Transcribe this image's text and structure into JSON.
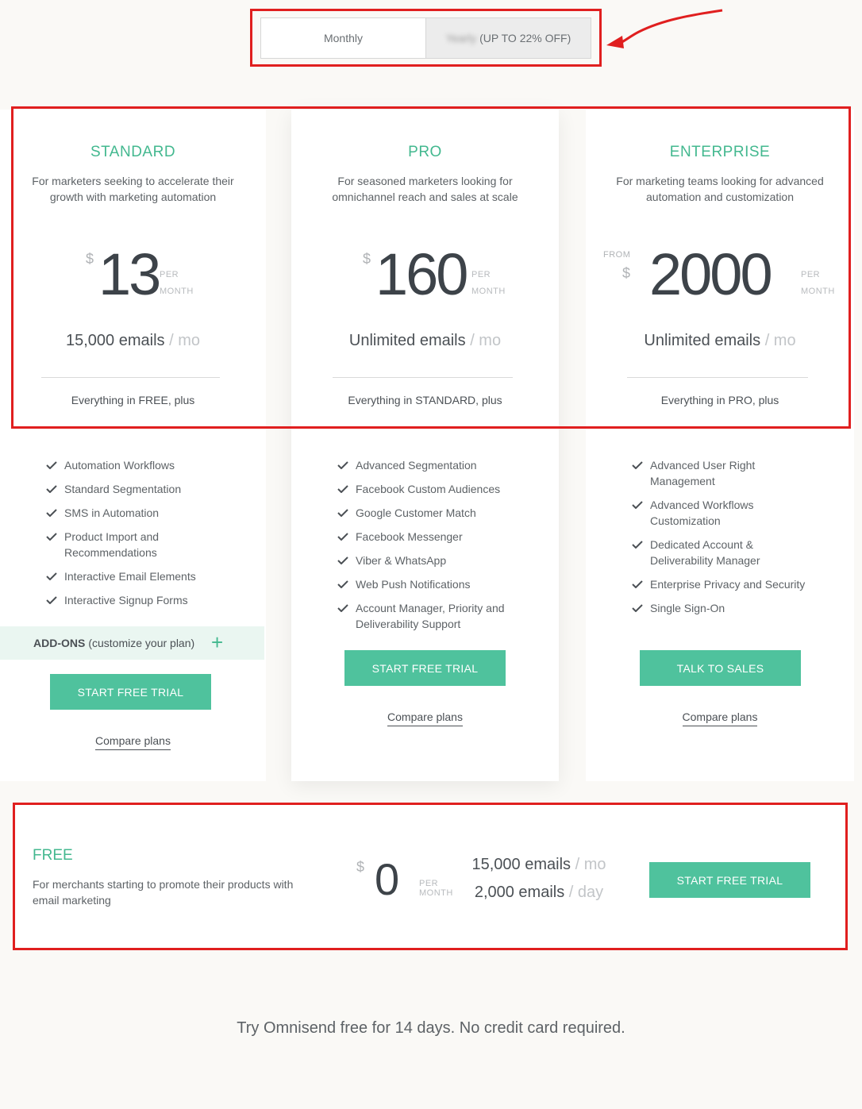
{
  "billing_toggle": {
    "monthly_label": "Monthly",
    "yearly_label": "Yearly",
    "yearly_discount": "(UP TO 22% OFF)"
  },
  "plans": [
    {
      "name": "STANDARD",
      "description": "For marketers seeking to accelerate their growth with marketing automation",
      "currency": "$",
      "from": "",
      "amount": "13",
      "per_1": "PER",
      "per_2": "MONTH",
      "emails": "15,000 emails",
      "emails_unit": "/ mo",
      "everything": "Everything in FREE, plus",
      "features": [
        "Automation Workflows",
        "Standard Segmentation",
        "SMS in Automation",
        "Product Import and Recommendations",
        "Interactive Email Elements",
        "Interactive Signup Forms"
      ],
      "addons_bold": "ADD-ONS",
      "addons_text": "(customize your plan)",
      "addons_plus": "+",
      "cta": "START FREE TRIAL",
      "compare": "Compare plans"
    },
    {
      "name": "PRO",
      "description": "For seasoned marketers looking for omnichannel reach and sales at scale",
      "currency": "$",
      "from": "",
      "amount": "160",
      "per_1": "PER",
      "per_2": "MONTH",
      "emails": "Unlimited emails",
      "emails_unit": "/ mo",
      "everything": "Everything in STANDARD, plus",
      "features": [
        "Advanced Segmentation",
        "Facebook Custom Audiences",
        "Google Customer Match",
        "Facebook Messenger",
        "Viber & WhatsApp",
        "Web Push Notifications",
        "Account Manager, Priority and Deliverability Support"
      ],
      "cta": "START FREE TRIAL",
      "compare": "Compare plans"
    },
    {
      "name": "ENTERPRISE",
      "description": "For marketing teams looking for advanced automation and customization",
      "currency": "$",
      "from": "FROM",
      "amount": "2000",
      "per_1": "PER",
      "per_2": "MONTH",
      "emails": "Unlimited emails",
      "emails_unit": "/ mo",
      "everything": "Everything in PRO, plus",
      "features": [
        "Advanced User Right Management",
        "Advanced Workflows Customization",
        "Dedicated Account & Deliverability Manager",
        "Enterprise Privacy and Security",
        "Single Sign-On"
      ],
      "cta": "TALK TO SALES",
      "compare": "Compare plans"
    }
  ],
  "free_plan": {
    "name": "FREE",
    "description": "For merchants starting to promote their products with email marketing",
    "currency": "$",
    "amount": "0",
    "per_1": "PER",
    "per_2": "MONTH",
    "emails_month": "15,000 emails",
    "emails_month_unit": "/ mo",
    "emails_day": "2,000 emails",
    "emails_day_unit": "/ day",
    "cta": "START FREE TRIAL"
  },
  "footer_note": "Try Omnisend free for 14 days. No credit card required.",
  "colors": {
    "accent": "#43b88f",
    "button": "#4fc29d",
    "highlight": "#e01f1f",
    "background": "#faf9f6"
  }
}
